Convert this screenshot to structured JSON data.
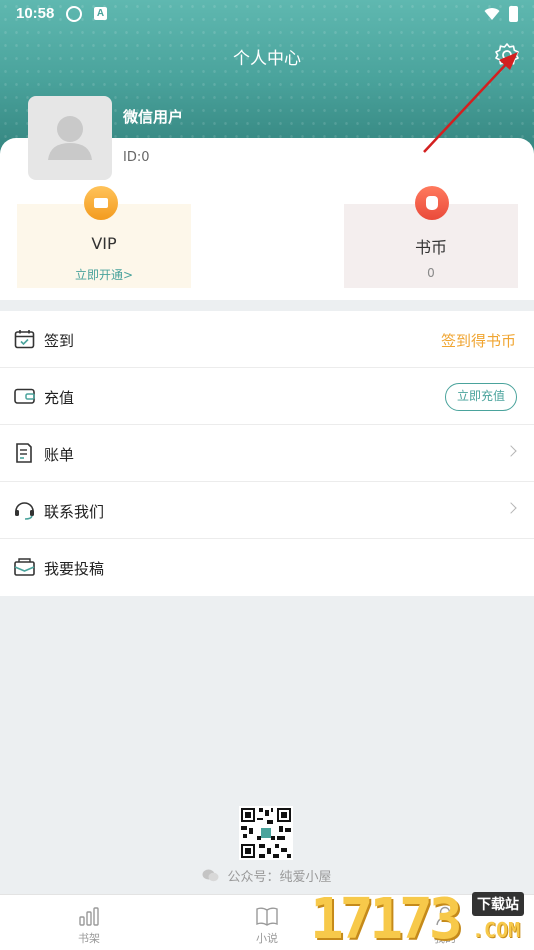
{
  "status_bar": {
    "time": "10:58",
    "icon_a": "A"
  },
  "header": {
    "title": "个人中心"
  },
  "user": {
    "name": "微信用户",
    "id": "ID:0"
  },
  "tiles": {
    "vip": {
      "title": "VIP",
      "subtitle": "立即开通>"
    },
    "coins": {
      "title": "书币",
      "value": "0"
    }
  },
  "menu": {
    "sign_in": {
      "label": "签到",
      "action": "签到得书币"
    },
    "recharge": {
      "label": "充值",
      "action": "立即充值"
    },
    "bill": {
      "label": "账单"
    },
    "contact": {
      "label": "联系我们"
    },
    "submit": {
      "label": "我要投稿"
    }
  },
  "footer": {
    "official_account": "公众号：纯爱小屋"
  },
  "nav": {
    "bookshelf": "书架",
    "novel": "小说",
    "mine": "我的"
  },
  "watermark": {
    "digits": "17173",
    "tag": "下载站",
    "suffix": ".COM"
  },
  "colors": {
    "accent": "#4aa39c",
    "orange": "#f0a532",
    "arrow": "#d32020"
  }
}
